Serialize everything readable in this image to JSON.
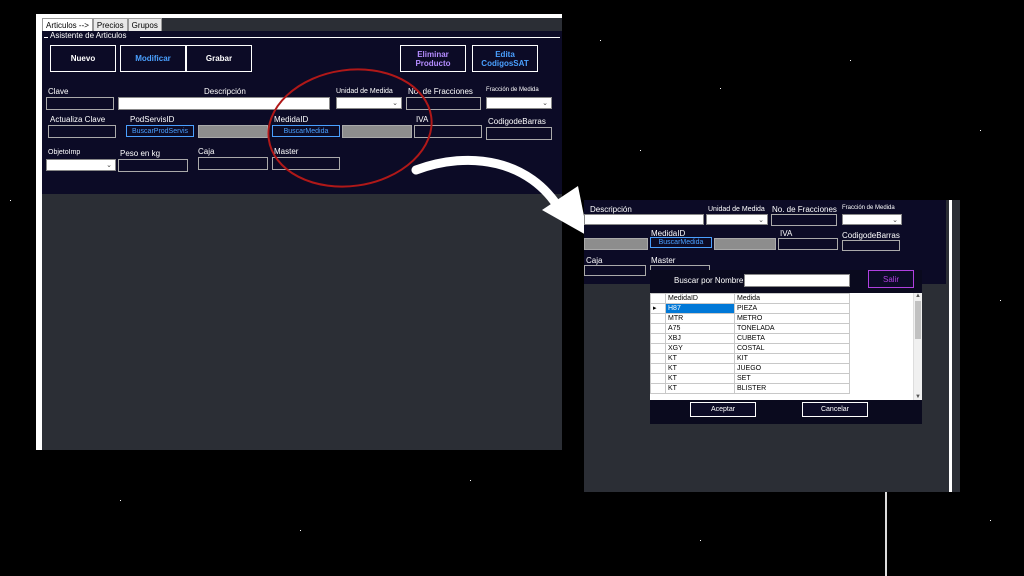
{
  "left_window": {
    "tabs": [
      "Articulos -->",
      "Precios",
      "Grupos"
    ],
    "group_title": "Asistente de Articulos",
    "buttons": {
      "nuevo": "Nuevo",
      "modificar": "Modificar",
      "grabar": "Grabar",
      "eliminar": "Eliminar Producto",
      "edita": "Edita CodigosSAT"
    },
    "labels": {
      "clave": "Clave",
      "descripcion": "Descripción",
      "unidad_medida": "Unidad de Medida",
      "no_fracciones": "No. de Fracciones",
      "fraccion_medida": "Fracción de Medida",
      "actualiza_clave": "Actualiza Clave",
      "podservisid": "PodServisID",
      "medidaid": "MedidaID",
      "iva": "IVA",
      "codigo_barras": "CodigodeBarras",
      "objetoimp": "ObjetoImp",
      "peso": "Peso en kg",
      "caja": "Caja",
      "master": "Master"
    },
    "small_buttons": {
      "buscar_prodservis": "BuscarProdServis",
      "buscar_medida": "BuscarMedida"
    }
  },
  "right_window": {
    "labels": {
      "descripcion": "Descripción",
      "unidad_medida": "Unidad de Medida",
      "no_fracciones": "No. de Fracciones",
      "fraccion_medida": "Fracción de Medida",
      "medidaid": "MedidaID",
      "iva": "IVA",
      "codigo_barras": "CodigodeBarras",
      "caja": "Caja",
      "master": "Master"
    },
    "buscar_medida": "BuscarMedida",
    "dialog": {
      "search_label": "Buscar por Nombre",
      "search_value": "",
      "salir": "Salir",
      "columns": [
        "MedidaID",
        "Medida"
      ],
      "rows": [
        {
          "id": "H87",
          "medida": "PIEZA"
        },
        {
          "id": "MTR",
          "medida": "METRO"
        },
        {
          "id": "A75",
          "medida": "TONELADA"
        },
        {
          "id": "XBJ",
          "medida": "CUBETA"
        },
        {
          "id": "XGY",
          "medida": "COSTAL"
        },
        {
          "id": "KT",
          "medida": "KIT"
        },
        {
          "id": "KT",
          "medida": "JUEGO"
        },
        {
          "id": "KT",
          "medida": "SET"
        },
        {
          "id": "KT",
          "medida": "BLISTER"
        }
      ],
      "aceptar": "Aceptar",
      "cancelar": "Cancelar"
    }
  },
  "colors": {
    "form_bg": "#0c0b26",
    "panel_bg": "#2b2e35",
    "highlight_circle": "#b01818",
    "accent_blue": "#4aa0ff",
    "eliminar_purple": "#b48cff",
    "salir_purple": "#b040e0"
  }
}
